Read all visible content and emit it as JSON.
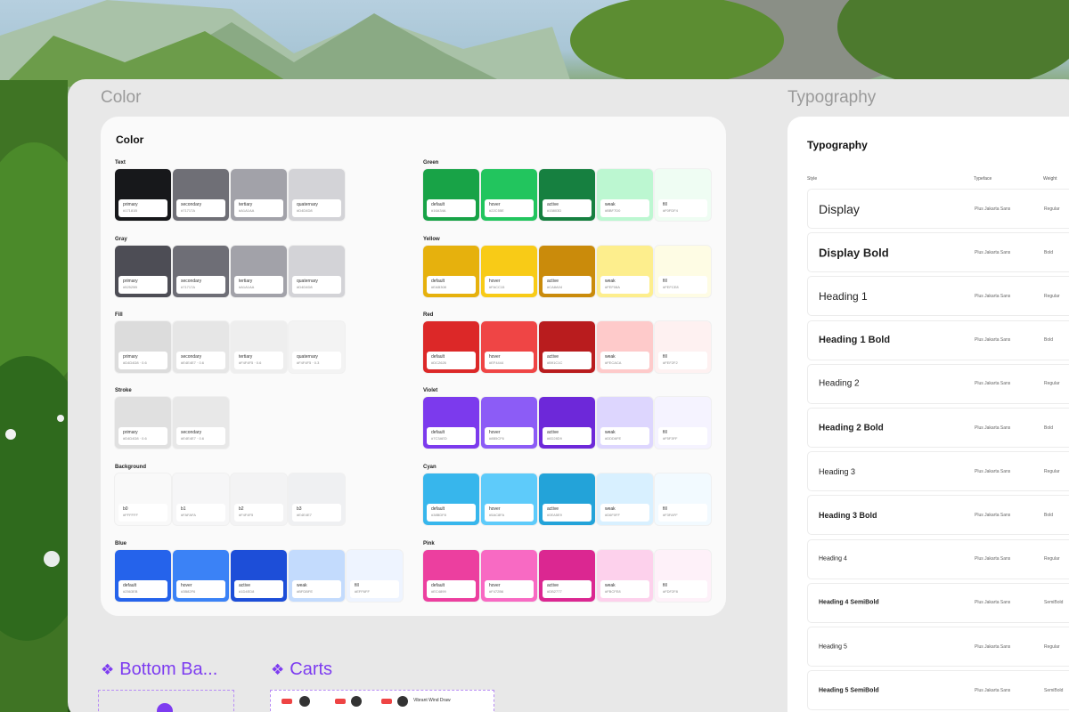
{
  "color_section": {
    "header": "Color",
    "card_title": "Color",
    "groups": [
      {
        "label": "Text",
        "swatches": [
          {
            "name": "primary",
            "hex": "#17181B",
            "color": "#17181b"
          },
          {
            "name": "secondary",
            "hex": "#71717A",
            "color": "#6f6f76"
          },
          {
            "name": "tertiary",
            "hex": "#A1A1AA",
            "color": "#a2a2a9"
          },
          {
            "name": "quaternary",
            "hex": "#D4D4D8",
            "color": "#d3d3d7"
          }
        ]
      },
      {
        "label": "Gray",
        "swatches": [
          {
            "name": "primary",
            "hex": "#52525B",
            "color": "#4d4d55"
          },
          {
            "name": "secondary",
            "hex": "#71717A",
            "color": "#6e6e76"
          },
          {
            "name": "tertiary",
            "hex": "#A1A1AA",
            "color": "#a2a2a9"
          },
          {
            "name": "quaternary",
            "hex": "#D4D4D8",
            "color": "#d3d3d7"
          }
        ]
      },
      {
        "label": "Fill",
        "swatches": [
          {
            "name": "primary",
            "hex": "#D4D4D8 · 0.6",
            "color": "#dcdcdc"
          },
          {
            "name": "secondary",
            "hex": "#E4E4E7 · 0.6",
            "color": "#e6e6e6"
          },
          {
            "name": "tertiary",
            "hex": "#F4F4F5 · 0.6",
            "color": "#eeeeee"
          },
          {
            "name": "quaternary",
            "hex": "#F4F4F5 · 0.3",
            "color": "#f3f3f3"
          }
        ]
      },
      {
        "label": "Stroke",
        "swatches": [
          {
            "name": "primary",
            "hex": "#D4D4D8 · 0.6",
            "color": "#e0e0e0"
          },
          {
            "name": "secondary",
            "hex": "#E4E4E7 · 0.6",
            "color": "#e8e8e8"
          }
        ]
      },
      {
        "label": "Background",
        "swatches": [
          {
            "name": "b0",
            "hex": "#FFFFFF",
            "color": "#f9f9f9"
          },
          {
            "name": "b1",
            "hex": "#FAFAFA",
            "color": "#f6f6f7"
          },
          {
            "name": "b2",
            "hex": "#F4F4F5",
            "color": "#f3f3f4"
          },
          {
            "name": "b3",
            "hex": "#E4E4E7",
            "color": "#eff0f2"
          }
        ]
      },
      {
        "label": "Blue",
        "swatches": [
          {
            "name": "default",
            "hex": "#2563EB",
            "color": "#2563eb"
          },
          {
            "name": "hover",
            "hex": "#3B82F6",
            "color": "#3b82f6"
          },
          {
            "name": "active",
            "hex": "#1D4ED8",
            "color": "#1d4ed8"
          },
          {
            "name": "weak",
            "hex": "#BFDBFE",
            "color": "#c3dbfd"
          },
          {
            "name": "fill",
            "hex": "#EFF6FF",
            "color": "#eef4ff"
          }
        ]
      },
      {
        "label": "Green",
        "swatches": [
          {
            "name": "default",
            "hex": "#16A34A",
            "color": "#18a347"
          },
          {
            "name": "hover",
            "hex": "#22C55E",
            "color": "#22c55e"
          },
          {
            "name": "active",
            "hex": "#15803D",
            "color": "#168040"
          },
          {
            "name": "weak",
            "hex": "#BBF7D0",
            "color": "#bcf7d1"
          },
          {
            "name": "fill",
            "hex": "#F0FDF4",
            "color": "#effdf3"
          }
        ]
      },
      {
        "label": "Yellow",
        "swatches": [
          {
            "name": "default",
            "hex": "#EAB308",
            "color": "#e6b10d"
          },
          {
            "name": "hover",
            "hex": "#FACC15",
            "color": "#f8cb17"
          },
          {
            "name": "active",
            "hex": "#CA8A04",
            "color": "#ca8b0b"
          },
          {
            "name": "weak",
            "hex": "#FEF08A",
            "color": "#fdee8d"
          },
          {
            "name": "fill",
            "hex": "#FEFCE8",
            "color": "#fefce4"
          }
        ]
      },
      {
        "label": "Red",
        "swatches": [
          {
            "name": "default",
            "hex": "#DC2626",
            "color": "#dc2828"
          },
          {
            "name": "hover",
            "hex": "#EF4444",
            "color": "#ef4545"
          },
          {
            "name": "active",
            "hex": "#B91C1C",
            "color": "#b91c1e"
          },
          {
            "name": "weak",
            "hex": "#FECACA",
            "color": "#fecaca"
          },
          {
            "name": "fill",
            "hex": "#FEF2F2",
            "color": "#fef1f1"
          }
        ]
      },
      {
        "label": "Violet",
        "swatches": [
          {
            "name": "default",
            "hex": "#7C3AED",
            "color": "#7c3aed"
          },
          {
            "name": "hover",
            "hex": "#8B5CF6",
            "color": "#8c5cf6"
          },
          {
            "name": "active",
            "hex": "#6D28D9",
            "color": "#6d28d9"
          },
          {
            "name": "weak",
            "hex": "#DDD6FE",
            "color": "#ddd6fe"
          },
          {
            "name": "fill",
            "hex": "#F5F3FF",
            "color": "#f5f3ff"
          }
        ]
      },
      {
        "label": "Cyan",
        "swatches": [
          {
            "name": "default",
            "hex": "#38BDF8",
            "color": "#37b6ec"
          },
          {
            "name": "hover",
            "hex": "#5AC8FA",
            "color": "#5ecbfa"
          },
          {
            "name": "active",
            "hex": "#0EA5E9",
            "color": "#23a3d9"
          },
          {
            "name": "weak",
            "hex": "#D6F0FF",
            "color": "#d8f0ff"
          },
          {
            "name": "fill",
            "hex": "#F3FAFF",
            "color": "#f2faff"
          }
        ]
      },
      {
        "label": "Pink",
        "swatches": [
          {
            "name": "default",
            "hex": "#EC4899",
            "color": "#ec3f9f"
          },
          {
            "name": "hover",
            "hex": "#F472B6",
            "color": "#f86ac3"
          },
          {
            "name": "active",
            "hex": "#DB2777",
            "color": "#db2791"
          },
          {
            "name": "weak",
            "hex": "#FBCFE8",
            "color": "#fdd1ec"
          },
          {
            "name": "fill",
            "hex": "#FDF2F8",
            "color": "#fef1f9"
          }
        ]
      }
    ]
  },
  "typography_section": {
    "header": "Typography",
    "card_title": "Typography",
    "columns": {
      "style": "Style",
      "typeface": "Typeface",
      "weight": "Weight"
    },
    "rows": [
      {
        "name": "Display",
        "typeface": "Plus Jakarta Sans",
        "weight": "Regular"
      },
      {
        "name": "Display Bold",
        "typeface": "Plus Jakarta Sans",
        "weight": "Bold"
      },
      {
        "name": "Heading 1",
        "typeface": "Plus Jakarta Sans",
        "weight": "Regular"
      },
      {
        "name": "Heading 1 Bold",
        "typeface": "Plus Jakarta Sans",
        "weight": "Bold"
      },
      {
        "name": "Heading 2",
        "typeface": "Plus Jakarta Sans",
        "weight": "Regular"
      },
      {
        "name": "Heading 2 Bold",
        "typeface": "Plus Jakarta Sans",
        "weight": "Bold"
      },
      {
        "name": "Heading 3",
        "typeface": "Plus Jakarta Sans",
        "weight": "Regular"
      },
      {
        "name": "Heading 3 Bold",
        "typeface": "Plus Jakarta Sans",
        "weight": "Bold"
      },
      {
        "name": "Heading 4",
        "typeface": "Plus Jakarta Sans",
        "weight": "Regular"
      },
      {
        "name": "Heading 4 SemiBold",
        "typeface": "Plus Jakarta Sans",
        "weight": "SemiBold"
      },
      {
        "name": "Heading 5",
        "typeface": "Plus Jakarta Sans",
        "weight": "Regular"
      },
      {
        "name": "Heading 5 SemiBold",
        "typeface": "Plus Jakarta Sans",
        "weight": "SemiBold"
      }
    ]
  },
  "components": {
    "bottom_bar": {
      "icon": "component-diamond-icon",
      "label": "Bottom Ba..."
    },
    "carts": {
      "icon": "component-diamond-icon",
      "label": "Carts",
      "preview_text": "Vibrant Wind Draw"
    }
  },
  "colors": {
    "accent": "#7d3cf0"
  }
}
